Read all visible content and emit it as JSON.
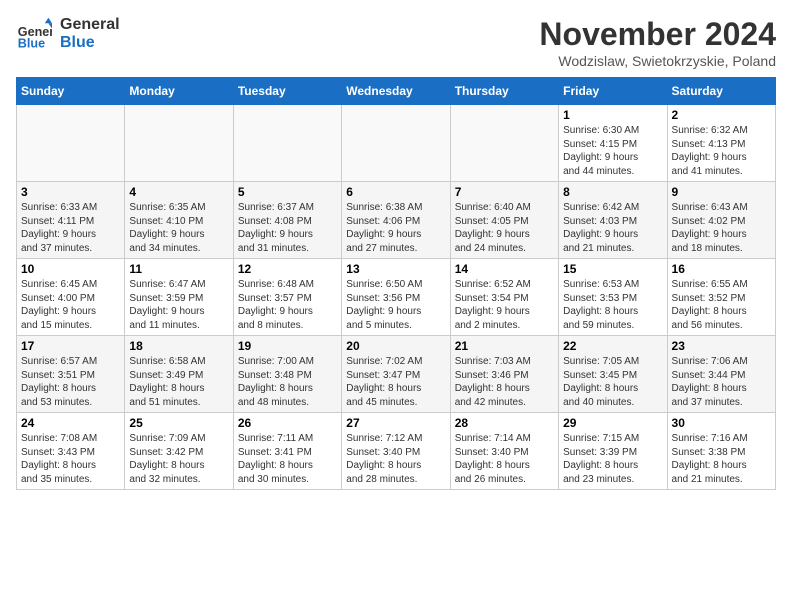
{
  "header": {
    "logo_line1": "General",
    "logo_line2": "Blue",
    "month": "November 2024",
    "location": "Wodzislaw, Swietokrzyskie, Poland"
  },
  "days_of_week": [
    "Sunday",
    "Monday",
    "Tuesday",
    "Wednesday",
    "Thursday",
    "Friday",
    "Saturday"
  ],
  "weeks": [
    [
      {
        "day": "",
        "info": ""
      },
      {
        "day": "",
        "info": ""
      },
      {
        "day": "",
        "info": ""
      },
      {
        "day": "",
        "info": ""
      },
      {
        "day": "",
        "info": ""
      },
      {
        "day": "1",
        "info": "Sunrise: 6:30 AM\nSunset: 4:15 PM\nDaylight: 9 hours\nand 44 minutes."
      },
      {
        "day": "2",
        "info": "Sunrise: 6:32 AM\nSunset: 4:13 PM\nDaylight: 9 hours\nand 41 minutes."
      }
    ],
    [
      {
        "day": "3",
        "info": "Sunrise: 6:33 AM\nSunset: 4:11 PM\nDaylight: 9 hours\nand 37 minutes."
      },
      {
        "day": "4",
        "info": "Sunrise: 6:35 AM\nSunset: 4:10 PM\nDaylight: 9 hours\nand 34 minutes."
      },
      {
        "day": "5",
        "info": "Sunrise: 6:37 AM\nSunset: 4:08 PM\nDaylight: 9 hours\nand 31 minutes."
      },
      {
        "day": "6",
        "info": "Sunrise: 6:38 AM\nSunset: 4:06 PM\nDaylight: 9 hours\nand 27 minutes."
      },
      {
        "day": "7",
        "info": "Sunrise: 6:40 AM\nSunset: 4:05 PM\nDaylight: 9 hours\nand 24 minutes."
      },
      {
        "day": "8",
        "info": "Sunrise: 6:42 AM\nSunset: 4:03 PM\nDaylight: 9 hours\nand 21 minutes."
      },
      {
        "day": "9",
        "info": "Sunrise: 6:43 AM\nSunset: 4:02 PM\nDaylight: 9 hours\nand 18 minutes."
      }
    ],
    [
      {
        "day": "10",
        "info": "Sunrise: 6:45 AM\nSunset: 4:00 PM\nDaylight: 9 hours\nand 15 minutes."
      },
      {
        "day": "11",
        "info": "Sunrise: 6:47 AM\nSunset: 3:59 PM\nDaylight: 9 hours\nand 11 minutes."
      },
      {
        "day": "12",
        "info": "Sunrise: 6:48 AM\nSunset: 3:57 PM\nDaylight: 9 hours\nand 8 minutes."
      },
      {
        "day": "13",
        "info": "Sunrise: 6:50 AM\nSunset: 3:56 PM\nDaylight: 9 hours\nand 5 minutes."
      },
      {
        "day": "14",
        "info": "Sunrise: 6:52 AM\nSunset: 3:54 PM\nDaylight: 9 hours\nand 2 minutes."
      },
      {
        "day": "15",
        "info": "Sunrise: 6:53 AM\nSunset: 3:53 PM\nDaylight: 8 hours\nand 59 minutes."
      },
      {
        "day": "16",
        "info": "Sunrise: 6:55 AM\nSunset: 3:52 PM\nDaylight: 8 hours\nand 56 minutes."
      }
    ],
    [
      {
        "day": "17",
        "info": "Sunrise: 6:57 AM\nSunset: 3:51 PM\nDaylight: 8 hours\nand 53 minutes."
      },
      {
        "day": "18",
        "info": "Sunrise: 6:58 AM\nSunset: 3:49 PM\nDaylight: 8 hours\nand 51 minutes."
      },
      {
        "day": "19",
        "info": "Sunrise: 7:00 AM\nSunset: 3:48 PM\nDaylight: 8 hours\nand 48 minutes."
      },
      {
        "day": "20",
        "info": "Sunrise: 7:02 AM\nSunset: 3:47 PM\nDaylight: 8 hours\nand 45 minutes."
      },
      {
        "day": "21",
        "info": "Sunrise: 7:03 AM\nSunset: 3:46 PM\nDaylight: 8 hours\nand 42 minutes."
      },
      {
        "day": "22",
        "info": "Sunrise: 7:05 AM\nSunset: 3:45 PM\nDaylight: 8 hours\nand 40 minutes."
      },
      {
        "day": "23",
        "info": "Sunrise: 7:06 AM\nSunset: 3:44 PM\nDaylight: 8 hours\nand 37 minutes."
      }
    ],
    [
      {
        "day": "24",
        "info": "Sunrise: 7:08 AM\nSunset: 3:43 PM\nDaylight: 8 hours\nand 35 minutes."
      },
      {
        "day": "25",
        "info": "Sunrise: 7:09 AM\nSunset: 3:42 PM\nDaylight: 8 hours\nand 32 minutes."
      },
      {
        "day": "26",
        "info": "Sunrise: 7:11 AM\nSunset: 3:41 PM\nDaylight: 8 hours\nand 30 minutes."
      },
      {
        "day": "27",
        "info": "Sunrise: 7:12 AM\nSunset: 3:40 PM\nDaylight: 8 hours\nand 28 minutes."
      },
      {
        "day": "28",
        "info": "Sunrise: 7:14 AM\nSunset: 3:40 PM\nDaylight: 8 hours\nand 26 minutes."
      },
      {
        "day": "29",
        "info": "Sunrise: 7:15 AM\nSunset: 3:39 PM\nDaylight: 8 hours\nand 23 minutes."
      },
      {
        "day": "30",
        "info": "Sunrise: 7:16 AM\nSunset: 3:38 PM\nDaylight: 8 hours\nand 21 minutes."
      }
    ]
  ]
}
